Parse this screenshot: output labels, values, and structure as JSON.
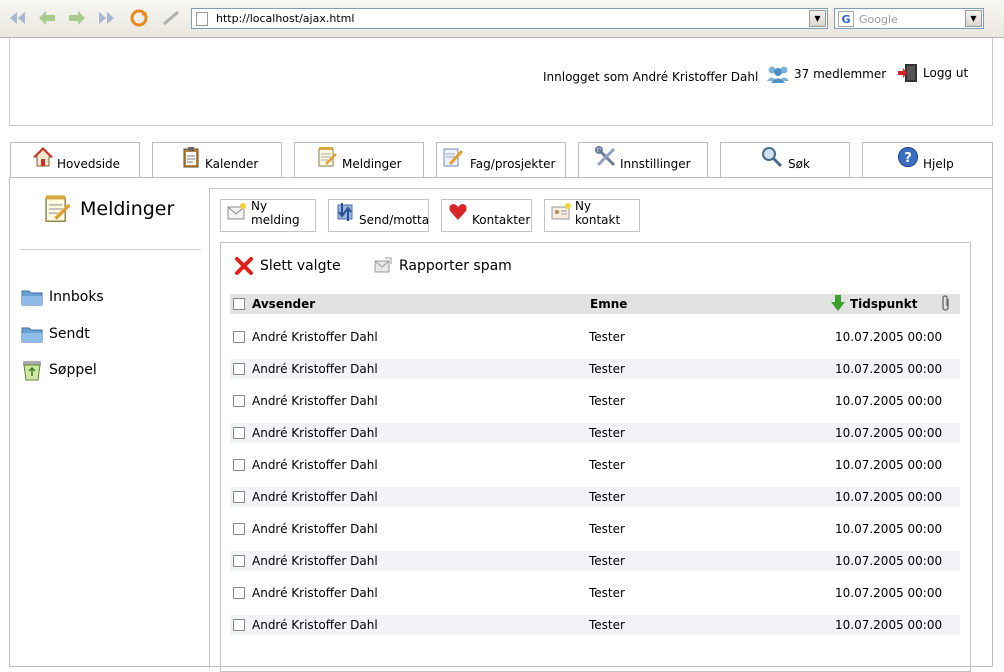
{
  "browser": {
    "url": "http://localhost/ajax.html",
    "search_placeholder": "Google",
    "search_engine_letter": "G"
  },
  "header": {
    "logged_in_text": "Innlogget som André Kristoffer Dahl",
    "members_text": "37 medlemmer",
    "logout_text": "Logg ut"
  },
  "tabs": [
    {
      "label": "Hovedside",
      "icon": "house-icon"
    },
    {
      "label": "Kalender",
      "icon": "clipboard-icon"
    },
    {
      "label": "Meldinger",
      "icon": "notepad-icon"
    },
    {
      "label": "Fag/prosjekter",
      "icon": "pencil-paper-icon"
    },
    {
      "label": "Innstillinger",
      "icon": "tools-icon"
    },
    {
      "label": "Søk",
      "icon": "magnifier-icon"
    },
    {
      "label": "Hjelp",
      "icon": "help-icon"
    }
  ],
  "sidebar": {
    "title": "Meldinger",
    "folders": [
      {
        "label": "Innboks",
        "icon": "folder-icon"
      },
      {
        "label": "Sendt",
        "icon": "folder-icon"
      },
      {
        "label": "Søppel",
        "icon": "recycle-bin-icon"
      }
    ]
  },
  "toolbar": {
    "new_message": "Ny melding",
    "send_receive": "Send/motta",
    "contacts": "Kontakter",
    "new_contact": "Ny kontakt"
  },
  "actions": {
    "delete_selected": "Slett valgte",
    "report_spam": "Rapporter spam"
  },
  "table": {
    "headers": {
      "sender": "Avsender",
      "subject": "Emne",
      "time": "Tidspunkt"
    },
    "rows": [
      {
        "sender": "André Kristoffer Dahl",
        "subject": "Tester",
        "time": "10.07.2005 00:00"
      },
      {
        "sender": "André Kristoffer Dahl",
        "subject": "Tester",
        "time": "10.07.2005 00:00"
      },
      {
        "sender": "André Kristoffer Dahl",
        "subject": "Tester",
        "time": "10.07.2005 00:00"
      },
      {
        "sender": "André Kristoffer Dahl",
        "subject": "Tester",
        "time": "10.07.2005 00:00"
      },
      {
        "sender": "André Kristoffer Dahl",
        "subject": "Tester",
        "time": "10.07.2005 00:00"
      },
      {
        "sender": "André Kristoffer Dahl",
        "subject": "Tester",
        "time": "10.07.2005 00:00"
      },
      {
        "sender": "André Kristoffer Dahl",
        "subject": "Tester",
        "time": "10.07.2005 00:00"
      },
      {
        "sender": "André Kristoffer Dahl",
        "subject": "Tester",
        "time": "10.07.2005 00:00"
      },
      {
        "sender": "André Kristoffer Dahl",
        "subject": "Tester",
        "time": "10.07.2005 00:00"
      },
      {
        "sender": "André Kristoffer Dahl",
        "subject": "Tester",
        "time": "10.07.2005 00:00"
      }
    ]
  }
}
